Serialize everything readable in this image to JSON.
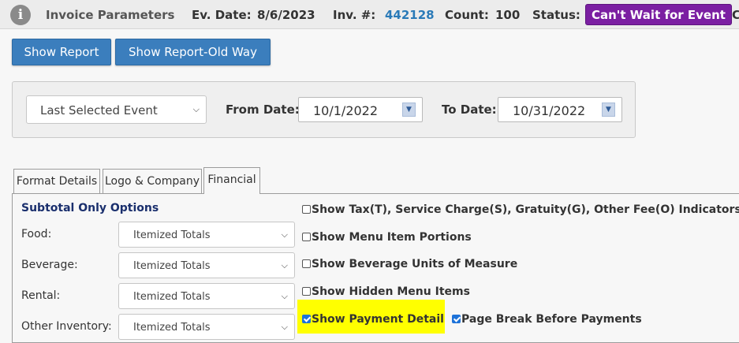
{
  "topbar": {
    "title": "Invoice Parameters",
    "ev_date_label": "Ev. Date:",
    "ev_date_value": "8/6/2023",
    "inv_label": "Inv. #:",
    "inv_value": "442128",
    "count_label": "Count:",
    "count_value": "100",
    "status_label": "Status:",
    "status_value": "Can't Wait for Event",
    "overflow_text": "C"
  },
  "actions": {
    "show_report": "Show Report",
    "show_report_old": "Show Report-Old Way"
  },
  "filters": {
    "event_select": "Last Selected Event",
    "from_label": "From Date:",
    "from_value": "10/1/2022",
    "to_label": "To Date:",
    "to_value": "10/31/2022"
  },
  "tabs": [
    {
      "label": "Format Details"
    },
    {
      "label": "Logo & Company"
    },
    {
      "label": "Financial"
    }
  ],
  "subtotal": {
    "title": "Subtotal Only Options",
    "rows": [
      {
        "label": "Food:",
        "value": "Itemized Totals"
      },
      {
        "label": "Beverage:",
        "value": "Itemized Totals"
      },
      {
        "label": "Rental:",
        "value": "Itemized Totals"
      },
      {
        "label": "Other Inventory:",
        "value": "Itemized Totals"
      }
    ]
  },
  "options": [
    {
      "label": "Show Tax(T), Service Charge(S), Gratuity(G), Other Fee(O) Indicators",
      "checked": false
    },
    {
      "label": "Show Menu Item Portions",
      "checked": false
    },
    {
      "label": "Show Beverage Units of Measure",
      "checked": false
    },
    {
      "label": "Show Hidden Menu Items",
      "checked": false
    },
    {
      "label": "Show Payment Detail",
      "checked": true
    },
    {
      "label": "Page Break Before Payments",
      "checked": true
    }
  ],
  "colors": {
    "accent": "#3b7ebd",
    "status_badge": "#7b1fa2",
    "highlight": "#ffff00",
    "link": "#2a7ab8"
  }
}
